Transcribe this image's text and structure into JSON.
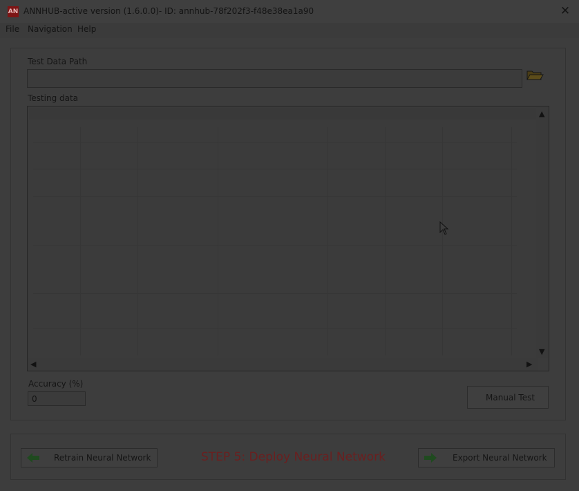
{
  "window": {
    "icon_text": "AN",
    "title": "ANNHUB-active version (1.6.0.0)- ID: annhub-78f202f3-f48e38ea1a90",
    "close_glyph": "✕"
  },
  "menu": [
    "File",
    "Navigation",
    "Help"
  ],
  "test_panel": {
    "path_label": "Test Data Path",
    "path_value": "",
    "table_label": "Testing data",
    "accuracy_label": "Accuracy (%)",
    "accuracy_value": "0",
    "manual_test_label": "Manual Test"
  },
  "footer": {
    "retrain_label": "Retrain Neural Network",
    "step_title": "STEP 5: Deploy Neural Network",
    "export_label": "Export Neural Network"
  },
  "icons": {
    "folder": "folder-open-icon",
    "back": "arrow-left-icon",
    "forward": "arrow-right-icon"
  },
  "colors": {
    "step_title": "#6b1f1f",
    "arrow_green": "#1f4a1f"
  }
}
